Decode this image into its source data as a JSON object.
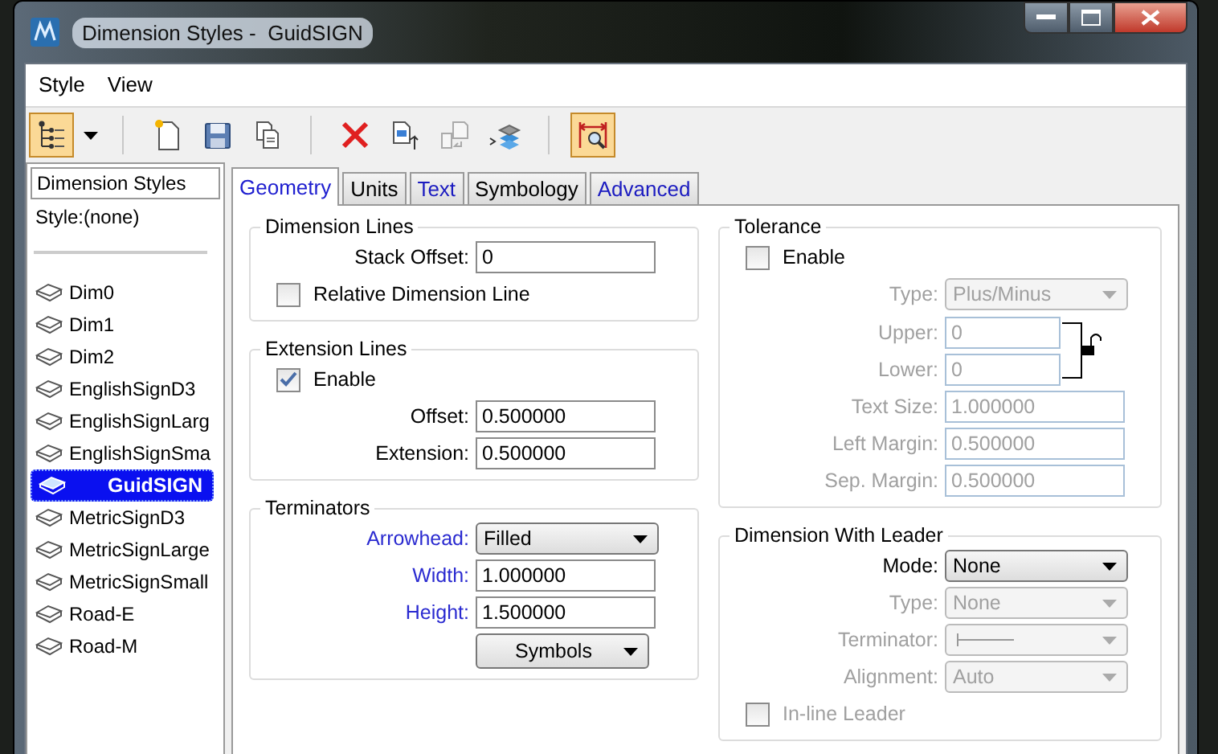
{
  "window": {
    "title": "Dimension Styles -  GuidSIGN"
  },
  "menu": [
    {
      "label": "Style"
    },
    {
      "label": "View"
    }
  ],
  "toolbar": [
    {
      "kind": "tree",
      "pressed": true
    },
    {
      "kind": "dropdown",
      "pressed": false
    },
    {
      "kind": "sep"
    },
    {
      "kind": "new",
      "pressed": false
    },
    {
      "kind": "save",
      "pressed": false
    },
    {
      "kind": "copy",
      "pressed": false
    },
    {
      "kind": "sep"
    },
    {
      "kind": "delete",
      "pressed": false
    },
    {
      "kind": "update",
      "pressed": false
    },
    {
      "kind": "reset",
      "pressed": false
    },
    {
      "kind": "import",
      "pressed": false
    },
    {
      "kind": "sep"
    },
    {
      "kind": "zoom",
      "pressed": true
    }
  ],
  "sidebar": {
    "header": "Dimension Styles",
    "filter": "Style:(none)",
    "items": [
      {
        "label": "Dim0",
        "selected": false
      },
      {
        "label": "Dim1",
        "selected": false
      },
      {
        "label": "Dim2",
        "selected": false
      },
      {
        "label": "EnglishSignD3",
        "selected": false
      },
      {
        "label": "EnglishSignLarg",
        "selected": false
      },
      {
        "label": "EnglishSignSma",
        "selected": false
      },
      {
        "label": "GuidSIGN",
        "selected": true
      },
      {
        "label": "MetricSignD3",
        "selected": false
      },
      {
        "label": "MetricSignLarge",
        "selected": false
      },
      {
        "label": "MetricSignSmall",
        "selected": false
      },
      {
        "label": "Road-E",
        "selected": false
      },
      {
        "label": "Road-M",
        "selected": false
      }
    ]
  },
  "tabs": [
    {
      "label": "Geometry",
      "selected": true
    },
    {
      "label": "Units",
      "selected": false
    },
    {
      "label": "Text",
      "selected": false
    },
    {
      "label": "Symbology",
      "selected": false
    },
    {
      "label": "Advanced",
      "selected": false
    }
  ],
  "columns": [
    [
      {
        "title": "Dimension Lines",
        "rows": [
          {
            "kind": "input",
            "label": "Stack Offset:",
            "value": "0",
            "disabled": false,
            "link": false
          },
          {
            "kind": "checkbox",
            "label": "Relative Dimension Line",
            "checked": false,
            "disabled": false
          }
        ]
      },
      {
        "title": "Extension Lines",
        "rows": [
          {
            "kind": "checkbox",
            "label": "Enable",
            "checked": true,
            "disabled": false
          },
          {
            "kind": "input",
            "label": "Offset:",
            "value": "0.500000",
            "disabled": false,
            "link": false
          },
          {
            "kind": "input",
            "label": "Extension:",
            "value": "0.500000",
            "disabled": false,
            "link": false
          }
        ]
      },
      {
        "title": "Terminators",
        "rows": [
          {
            "kind": "select",
            "label": "Arrowhead:",
            "value": "Filled",
            "disabled": false,
            "link": true
          },
          {
            "kind": "input",
            "label": "Width:",
            "value": "1.000000",
            "disabled": false,
            "link": true
          },
          {
            "kind": "input",
            "label": "Height:",
            "value": "1.500000",
            "disabled": false,
            "link": true
          },
          {
            "kind": "button",
            "value": "Symbols",
            "disabled": false
          }
        ]
      }
    ],
    [
      {
        "title": "Tolerance",
        "rows": [
          {
            "kind": "checkbox",
            "label": "Enable",
            "checked": false,
            "disabled": false
          },
          {
            "kind": "select",
            "label": "Type:",
            "value": "Plus/Minus",
            "disabled": true,
            "link": false
          },
          {
            "kind": "lockpair",
            "disabled": true,
            "rows": [
              {
                "label": "Upper:",
                "value": "0"
              },
              {
                "label": "Lower:",
                "value": "0"
              }
            ]
          },
          {
            "kind": "input",
            "label": "Text Size:",
            "value": "1.000000",
            "disabled": true,
            "link": false
          },
          {
            "kind": "input",
            "label": "Left Margin:",
            "value": "0.500000",
            "disabled": true,
            "link": false
          },
          {
            "kind": "input",
            "label": "Sep. Margin:",
            "value": "0.500000",
            "disabled": true,
            "link": false
          }
        ]
      },
      {
        "title": "Dimension With Leader",
        "rows": [
          {
            "kind": "select",
            "label": "Mode:",
            "value": "None",
            "disabled": false,
            "link": false
          },
          {
            "kind": "select",
            "label": "Type:",
            "value": "None",
            "disabled": true,
            "link": false
          },
          {
            "kind": "terminator",
            "label": "Terminator:",
            "disabled": true,
            "link": false
          },
          {
            "kind": "select",
            "label": "Alignment:",
            "value": "Auto",
            "disabled": true,
            "link": false
          },
          {
            "kind": "checkbox",
            "label": "In-line Leader",
            "checked": false,
            "disabled": true
          }
        ]
      }
    ]
  ]
}
